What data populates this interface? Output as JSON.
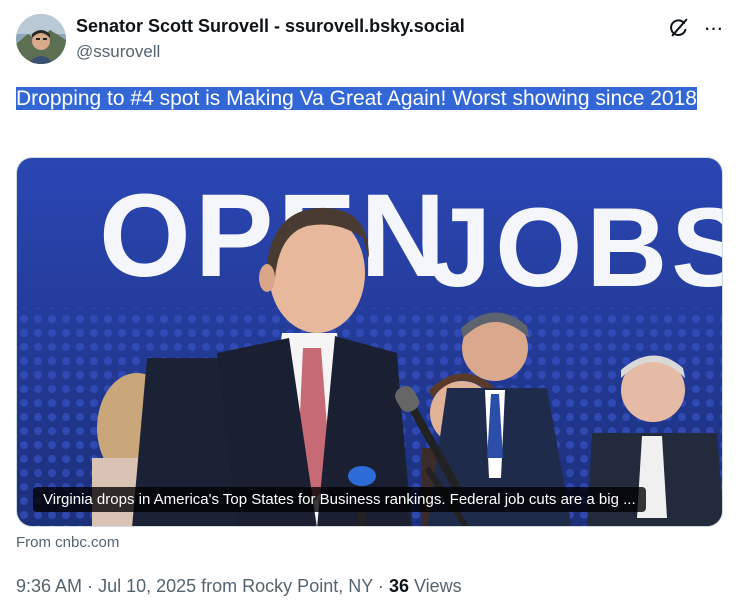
{
  "author": {
    "display_name": "Senator Scott Surovell - ssurovell.bsky.social",
    "handle": "@ssurovell",
    "avatar_icon": "avatar-photo"
  },
  "header_actions": {
    "grok_icon": "grok-icon",
    "more_icon": "more-icon",
    "more_label": "···"
  },
  "tweet": {
    "text": "Dropping to #4 spot is Making Va Great Again!  Worst showing since 2018"
  },
  "link_card": {
    "image_sign_text": "OPEN JOBS",
    "caption": "Virginia drops in America's Top States for Business rankings. Federal job cuts are a big ...",
    "source": "From cnbc.com"
  },
  "meta": {
    "time": "9:36 AM",
    "date": "Jul 10, 2025",
    "location": "from Rocky Point, NY",
    "separator": "·",
    "views_count": "36",
    "views_label": "Views"
  },
  "colors": {
    "selection": "#3367d6",
    "backdrop": "#2a46b3",
    "muted_text": "#536471"
  }
}
